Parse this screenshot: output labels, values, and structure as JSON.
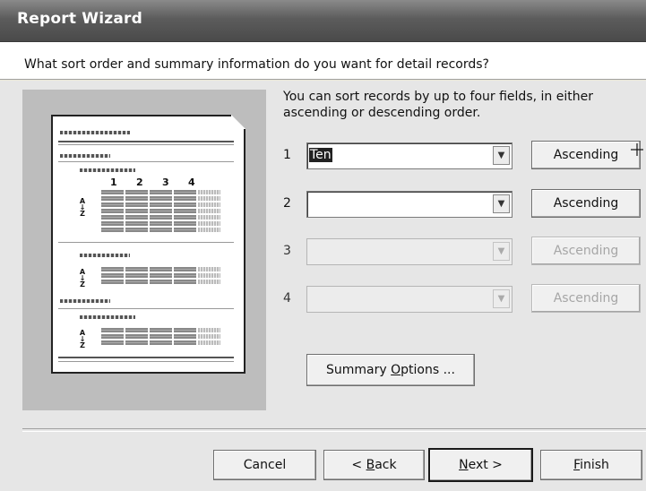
{
  "window": {
    "title": "Report Wizard",
    "question": "What sort order and summary information do you want for detail records?"
  },
  "instructions": "You can sort records by up to four fields, in either ascending or descending order.",
  "preview": {
    "column_numbers": [
      "1",
      "2",
      "3",
      "4"
    ],
    "sort_glyph": "A↓Z"
  },
  "sort_rows": [
    {
      "number": "1",
      "field": "Ten",
      "order": "Ascending",
      "enabled": true
    },
    {
      "number": "2",
      "field": "",
      "order": "Ascending",
      "enabled": true
    },
    {
      "number": "3",
      "field": "",
      "order": "Ascending",
      "enabled": false
    },
    {
      "number": "4",
      "field": "",
      "order": "Ascending",
      "enabled": false
    }
  ],
  "summary_button": {
    "prefix": "Summary ",
    "accel": "O",
    "suffix": "ptions ..."
  },
  "footer": {
    "cancel": "Cancel",
    "back": {
      "prefix": "< ",
      "accel": "B",
      "suffix": "ack"
    },
    "next": {
      "accel": "N",
      "suffix": "ext >"
    },
    "finish": {
      "accel": "F",
      "suffix": "inish"
    }
  },
  "icons": {
    "dropdown": "chevron-down-icon",
    "cursor": "crosshair-cursor-icon"
  }
}
